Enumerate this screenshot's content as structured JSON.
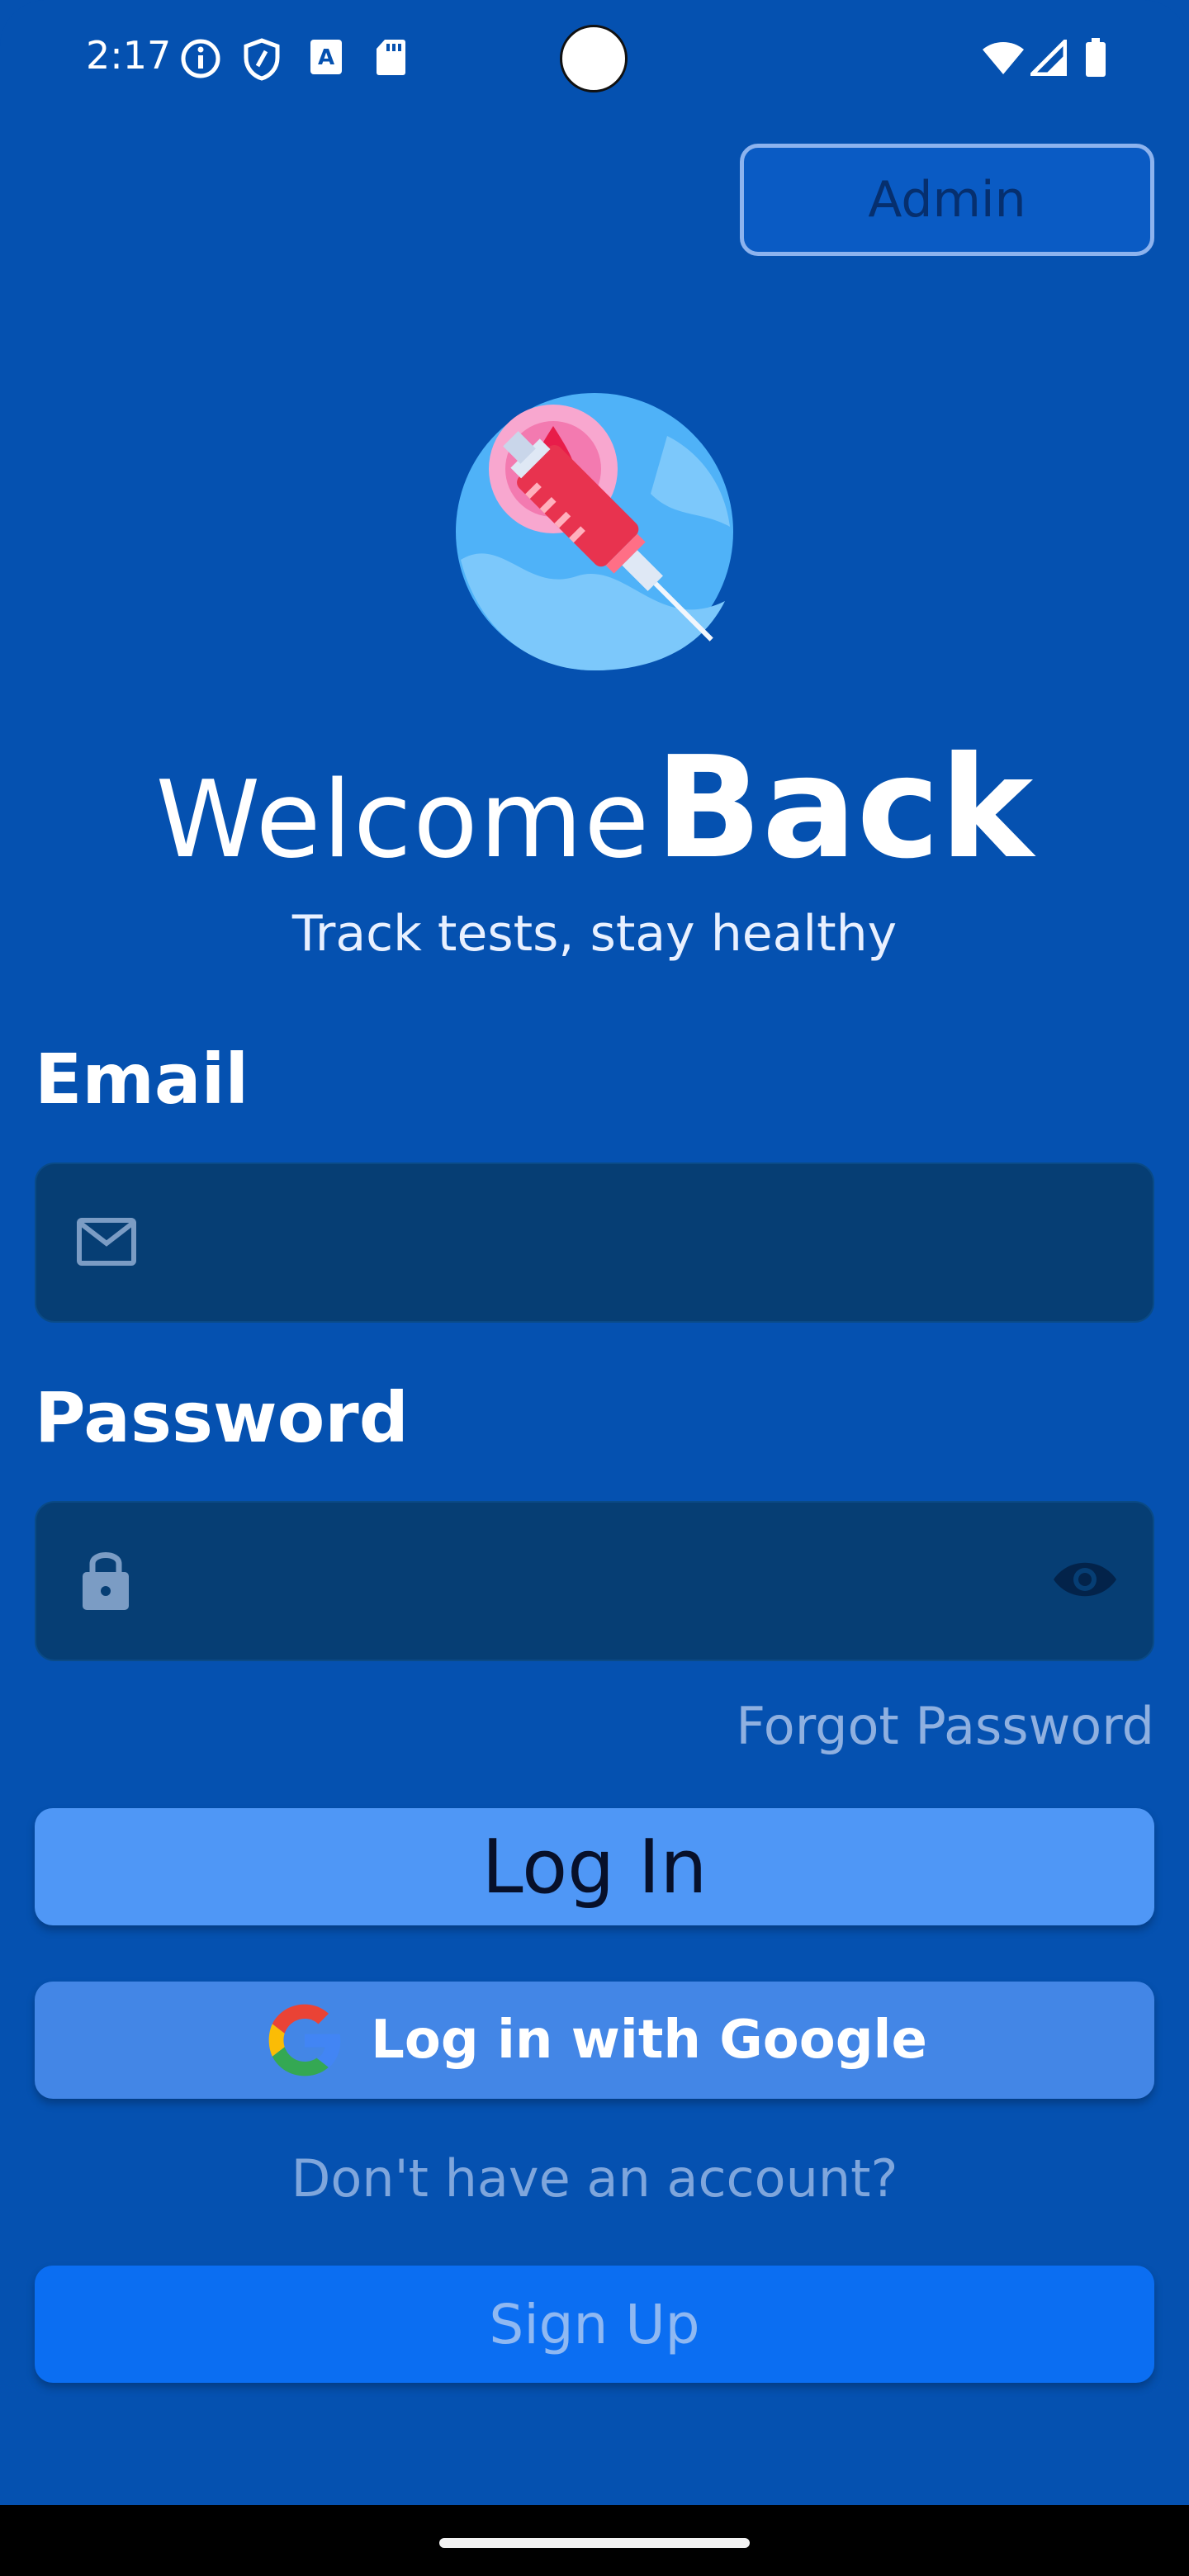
{
  "status_bar": {
    "time": "2:17",
    "left_icons": [
      "info-icon",
      "shield-icon",
      "text-a-icon",
      "sd-card-icon"
    ],
    "right_icons": [
      "wifi-icon",
      "signal-icon",
      "battery-icon"
    ]
  },
  "header": {
    "admin_label": "Admin"
  },
  "hero": {
    "logo": "blood-test-syringe-logo",
    "welcome_light": "Welcome",
    "welcome_bold": "Back",
    "subtitle": "Track tests, stay healthy"
  },
  "form": {
    "email_label": "Email",
    "email_value": "",
    "email_icon": "mail-icon",
    "password_label": "Password",
    "password_value": "",
    "password_icon": "lock-icon",
    "password_toggle_icon": "eye-icon",
    "forgot_password": "Forgot Password"
  },
  "actions": {
    "login_label": "Log In",
    "google_label": "Log in with Google",
    "no_account": "Don't have an account?",
    "signup_label": "Sign Up"
  },
  "colors": {
    "background": "#0551b0",
    "input_bg": "#063e74",
    "login_btn": "#4f97f6",
    "google_btn": "#4386e6",
    "signup_btn": "#0b6ef2"
  }
}
